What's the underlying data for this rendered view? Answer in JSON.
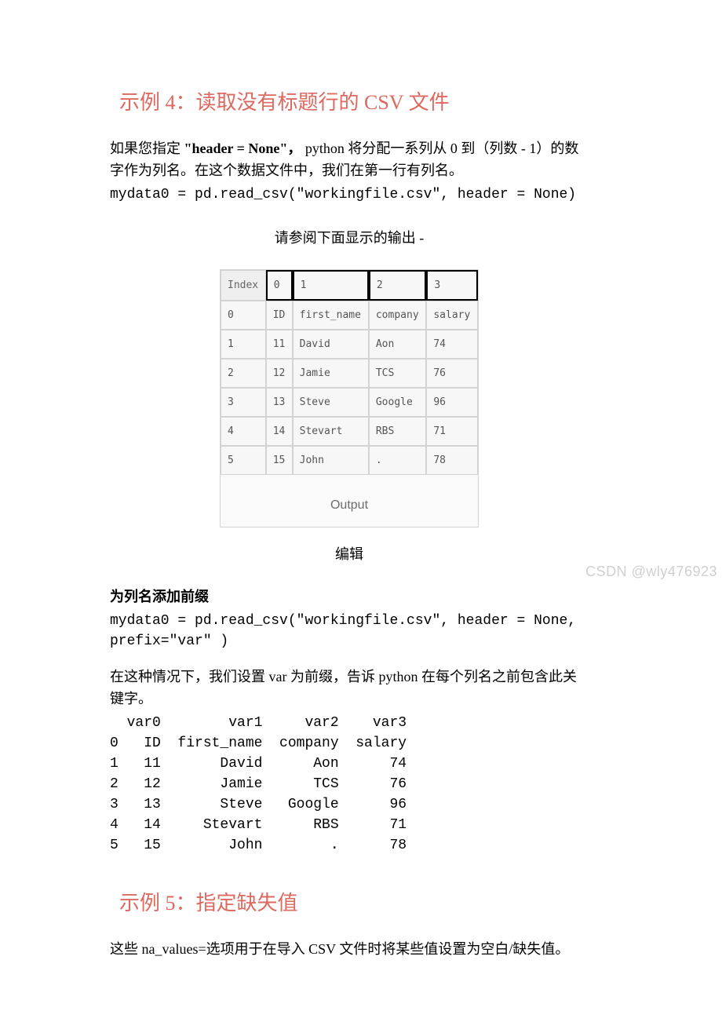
{
  "h2_example4": "示例 4：读取没有标题行的 CSV 文件",
  "p1_part1": "如果您指定",
  "p1_bold": "\"header = None\"，",
  "p1_part2": "  python 将分配一系列从 0 到（列数 - 1）的数字作为列名。在这个数据文件中，我们在第一行有列名。",
  "code1": "mydata0 = pd.read_csv(\"workingfile.csv\", header = None)",
  "center1": "请参阅下面显示的输出 -",
  "table": {
    "index_label": "Index",
    "cols": [
      "0",
      "1",
      "2",
      "3"
    ],
    "rows": [
      {
        "idx": "0",
        "c": [
          "ID",
          "first_name",
          "company",
          "salary"
        ]
      },
      {
        "idx": "1",
        "c": [
          "11",
          "David",
          "Aon",
          "74"
        ]
      },
      {
        "idx": "2",
        "c": [
          "12",
          "Jamie",
          "TCS",
          "76"
        ]
      },
      {
        "idx": "3",
        "c": [
          "13",
          "Steve",
          "Google",
          "96"
        ]
      },
      {
        "idx": "4",
        "c": [
          "14",
          "Stevart",
          "RBS",
          "71"
        ]
      },
      {
        "idx": "5",
        "c": [
          "15",
          "John",
          ".",
          "78"
        ]
      }
    ],
    "output_label": "Output"
  },
  "edit_label": "编辑",
  "prefix_heading": "为列名添加前缀",
  "code2": "mydata0 = pd.read_csv(\"workingfile.csv\", header = None, prefix=\"var\" )",
  "p2": "在这种情况下，我们设置 var 为前缀，告诉 python 在每个列名之前包含此关键字。",
  "text_table": "  var0        var1     var2    var3\n0   ID  first_name  company  salary\n1   11       David      Aon      74\n2   12       Jamie      TCS      76\n3   13       Steve   Google      96\n4   14     Stevart      RBS      71\n5   15        John        .      78",
  "h2_example5": "示例 5：指定缺失值",
  "p3": "这些 na_values=选项用于在导入 CSV 文件时将某些值设置为空白/缺失值。",
  "watermark": "CSDN @wly476923"
}
